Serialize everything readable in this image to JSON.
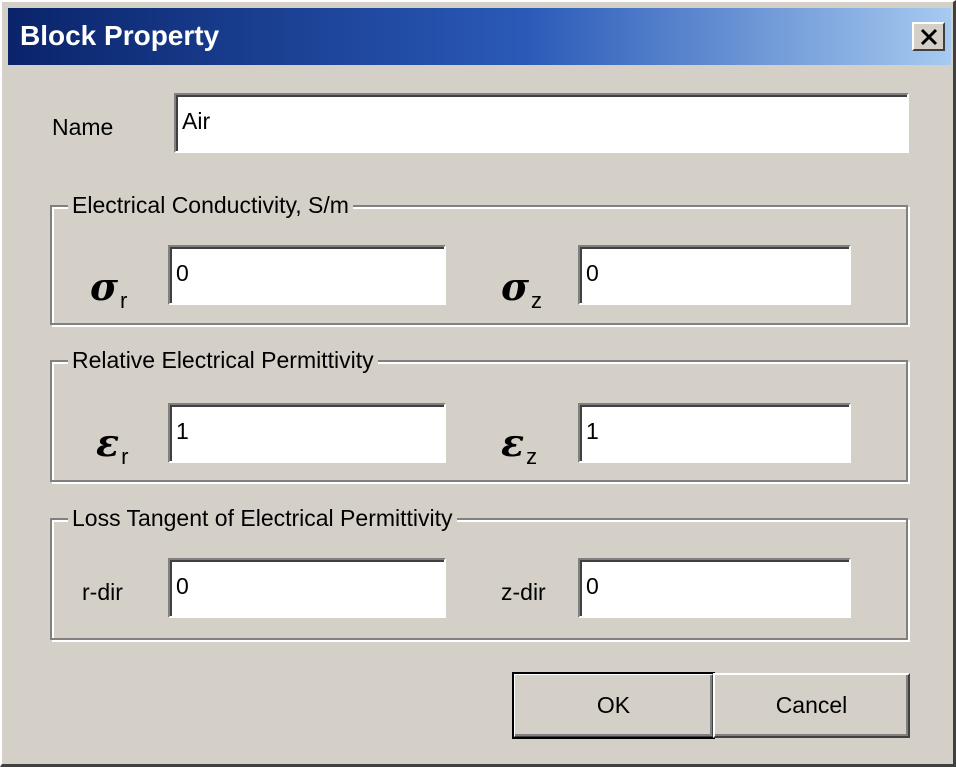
{
  "window": {
    "title": "Block Property",
    "close_icon": "close-icon"
  },
  "name": {
    "label": "Name",
    "value": "Air"
  },
  "conductivity": {
    "group_title": "Electrical Conductivity, S/m",
    "r_symbol": "σ",
    "r_sub": "r",
    "r_value": "0",
    "z_symbol": "σ",
    "z_sub": "z",
    "z_value": "0"
  },
  "permittivity": {
    "group_title": "Relative Electrical Permittivity",
    "r_symbol": "ε",
    "r_sub": "r",
    "r_value": "1",
    "z_symbol": "ε",
    "z_sub": "z",
    "z_value": "1"
  },
  "loss_tangent": {
    "group_title": "Loss Tangent of Electrical Permittivity",
    "r_label": "r-dir",
    "r_value": "0",
    "z_label": "z-dir",
    "z_value": "0"
  },
  "buttons": {
    "ok_label": "OK",
    "cancel_label": "Cancel"
  },
  "colors": {
    "face": "#d4d0c8",
    "title_start": "#0a246a",
    "title_end": "#a6caf0"
  }
}
